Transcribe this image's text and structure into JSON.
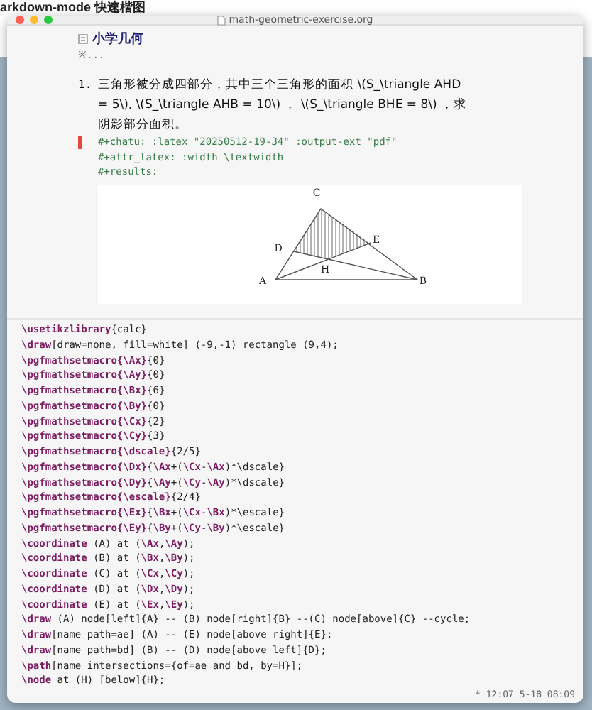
{
  "background_page": {
    "title": "arkdown-mode 快速楷图"
  },
  "window": {
    "title": "math-geometric-exercise.org"
  },
  "heading": {
    "title": "小学几何",
    "folded": "※..."
  },
  "problem": {
    "number": "1.",
    "text": "三角形被分成四部分，其中三个三角形的面积 \\(S_\\triangle AHD = 5\\), \\(S_\\triangle AHB = 10\\) ， \\(S_\\triangle BHE = 8\\) ，求阴影部分面积。"
  },
  "keywords": [
    "#+chatu: :latex \"20250512-19-34\" :output-ext \"pdf\"",
    "#+attr_latex: :width \\textwidth",
    "#+results:"
  ],
  "figure": {
    "labels": [
      "C",
      "D",
      "E",
      "H",
      "A",
      "B"
    ]
  },
  "code_lines": [
    "**\\usetikzlibrary**{calc}",
    "**\\draw**[draw=none, fill=white] (-9,-1) rectangle (9,4);",
    "**\\pgfmathsetmacro{\\Ax}**{0}",
    "**\\pgfmathsetmacro{\\Ay}**{0}",
    "**\\pgfmathsetmacro{\\Bx}**{6}",
    "**\\pgfmathsetmacro{\\By}**{0}",
    "**\\pgfmathsetmacro{\\Cx}**{2}",
    "**\\pgfmathsetmacro{\\Cy}**{3}",
    "**\\pgfmathsetmacro{\\dscale}**{2/5}",
    "**\\pgfmathsetmacro{\\Dx}**{**\\Ax**+(**\\Cx**-**\\Ax**)*\\dscale}",
    "**\\pgfmathsetmacro{\\Dy}**{**\\Ay**+(**\\Cy**-**\\Ay**)*\\dscale}",
    "**\\pgfmathsetmacro{\\escale}**{2/4}",
    "**\\pgfmathsetmacro{\\Ex}**{**\\Bx**+(**\\Cx**-**\\Bx**)*\\escale}",
    "**\\pgfmathsetmacro{\\Ey}**{**\\By**+(**\\Cy**-**\\By**)*\\escale}",
    "**\\coordinate** (A) at (**\\Ax**,**\\Ay**);",
    "**\\coordinate** (B) at (**\\Bx**,**\\By**);",
    "**\\coordinate** (C) at (**\\Cx**,**\\Cy**);",
    "**\\coordinate** (D) at (**\\Dx**,**\\Dy**);",
    "**\\coordinate** (E) at (**\\Ex**,**\\Ey**);",
    "**\\draw** (A) node[left]{A} -- (B) node[right]{B} --(C) node[above]{C} --cycle;",
    "**\\draw**[name path=ae] (A) -- (E) node[above right]{E};",
    "**\\draw**[name path=bd] (B) -- (D) node[above left]{D};",
    "**\\path**[name intersections={of=ae and bd, by=H}];",
    "**\\node** at (H) [below]{H};"
  ],
  "status": "* 12:07 5-18 08:09"
}
